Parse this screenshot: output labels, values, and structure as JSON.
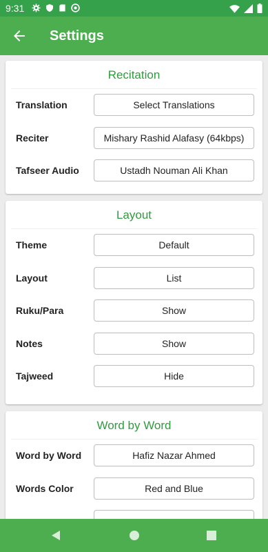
{
  "status_bar": {
    "time": "9:31"
  },
  "app_bar": {
    "title": "Settings"
  },
  "sections": {
    "recitation": {
      "title": "Recitation",
      "rows": [
        {
          "label": "Translation",
          "value": "Select Translations"
        },
        {
          "label": "Reciter",
          "value": "Mishary Rashid Alafasy (64kbps)"
        },
        {
          "label": "Tafseer Audio",
          "value": "Ustadh Nouman Ali Khan"
        }
      ]
    },
    "layout": {
      "title": "Layout",
      "rows": [
        {
          "label": "Theme",
          "value": "Default"
        },
        {
          "label": "Layout",
          "value": "List"
        },
        {
          "label": "Ruku/Para",
          "value": "Show"
        },
        {
          "label": "Notes",
          "value": "Show"
        },
        {
          "label": "Tajweed",
          "value": "Hide"
        }
      ]
    },
    "word_by_word": {
      "title": "Word by Word",
      "rows": [
        {
          "label": "Word by Word",
          "value": "Hafiz Nazar Ahmed"
        },
        {
          "label": "Words Color",
          "value": "Red and Blue"
        }
      ]
    }
  },
  "colors": {
    "primary": "#4cae4f",
    "status": "#35a14a",
    "accent_text": "#2e9c3c"
  }
}
